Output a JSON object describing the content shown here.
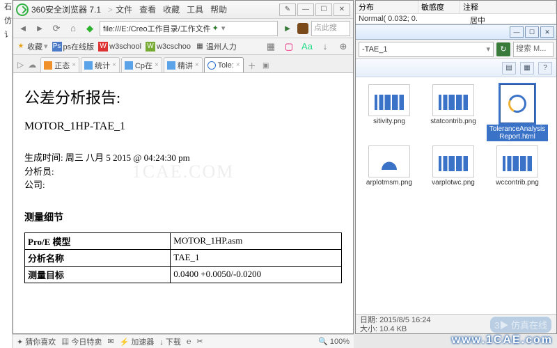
{
  "left_frag": [
    "石",
    "仿",
    "讠"
  ],
  "browser": {
    "title": "360安全浏览器 7.1",
    "menus": [
      "文件",
      "查看",
      "收藏",
      "工具",
      "帮助"
    ],
    "url": "file:///E:/Creo工作目录/工作文件",
    "search_placeholder": "点此搜",
    "bookmarks": {
      "fav": "收藏",
      "items": [
        "ps在线版",
        "w3school",
        "w3cschoo",
        "温州人力"
      ]
    },
    "tabs": [
      {
        "label": "正态",
        "fav": "f-orange"
      },
      {
        "label": "统计",
        "fav": "f-blue"
      },
      {
        "label": "Cp在",
        "fav": "f-blue"
      },
      {
        "label": "精讲",
        "fav": "f-blue"
      },
      {
        "label": "Tole:",
        "fav": "f-ie",
        "active": true
      }
    ],
    "doc": {
      "h1": "公差分析报告:",
      "h2": "MOTOR_1HP-TAE_1",
      "gen_label": "生成时间:",
      "gen_value": "周三 八月 5 2015 @ 04:24:30 pm",
      "analyst_label": "分析员:",
      "company_label": "公司:",
      "section": "测量细节",
      "table": [
        [
          "Pro/E 模型",
          "MOTOR_1HP.asm"
        ],
        [
          "分析名称",
          "TAE_1"
        ],
        [
          "测量目标",
          "0.0400 +0.0050/-0.0200"
        ]
      ]
    },
    "statusbar": [
      "猜你喜欢",
      "今日特卖",
      "",
      "加速器",
      "下载",
      "",
      "",
      "100%"
    ]
  },
  "explorer": {
    "top_headers": [
      "分布",
      "敏感度",
      "注释"
    ],
    "top_row1": "Normal( 0.032; 0.",
    "top_row2": "居中",
    "crumb": "-TAE_1",
    "search": "搜索 M...",
    "files": [
      {
        "name": "sitivity.png",
        "type": "chart"
      },
      {
        "name": "statcontrib.png",
        "type": "chart"
      },
      {
        "name": "ToleranceAnalysisReport.html",
        "type": "html",
        "selected": true
      },
      {
        "name": "arplotmsm.png",
        "type": "bell"
      },
      {
        "name": "varplotwc.png",
        "type": "chart"
      },
      {
        "name": "wccontrib.png",
        "type": "chart"
      }
    ],
    "status_line1": "日期: 2015/8/5 16:24",
    "status_line2": "大小: 10.4 KB"
  },
  "watermark": "1CAE.COM",
  "site_wm": "www.1CAE.com",
  "site_wm2": "3▶ 仿真在线"
}
